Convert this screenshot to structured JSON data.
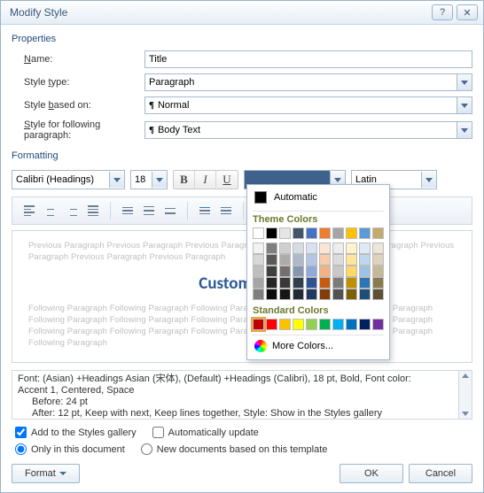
{
  "titlebar": {
    "title": "Modify Style",
    "help": "?",
    "close": "✕"
  },
  "sections": {
    "properties": "Properties",
    "formatting": "Formatting"
  },
  "props": {
    "name_label": "Name:",
    "name_value": "Title",
    "type_label": "Style type:",
    "type_value": "Paragraph",
    "based_label": "Style based on:",
    "based_value": "Normal",
    "based_icon": "¶",
    "follow_label": "Style for following paragraph:",
    "follow_value": "Body Text",
    "follow_icon": "¶"
  },
  "format": {
    "font": "Calibri (Headings)",
    "size": "18",
    "script": "Latin"
  },
  "preview": {
    "ghost_prev": "Previous Paragraph Previous Paragraph Previous Paragraph Previous Paragraph Previous Paragraph Previous Paragraph Previous Paragraph Previous Paragraph",
    "title": "Custom Wor",
    "ghost_foll": "Following Paragraph Following Paragraph Following Paragraph Following Paragraph Following Paragraph Following Paragraph Following Paragraph Following Paragraph Following Paragraph Following Paragraph Following Paragraph Following Paragraph Following Paragraph Following Paragraph Following Paragraph Following Paragraph"
  },
  "desc": {
    "l1": "Font: (Asian) +Headings Asian (宋体), (Default) +Headings (Calibri), 18 pt, Bold, Font color:",
    "l2": "Accent 1, Centered, Space",
    "l3": "Before:  24 pt",
    "l4": "After:  12 pt, Keep with next, Keep lines together, Style: Show in the Styles gallery"
  },
  "opts": {
    "add_gallery": "Add to the Styles gallery",
    "auto_update": "Automatically update",
    "only_doc": "Only in this document",
    "new_docs": "New documents based on this template"
  },
  "buttons": {
    "format": "Format",
    "ok": "OK",
    "cancel": "Cancel"
  },
  "popup": {
    "automatic": "Automatic",
    "theme": "Theme Colors",
    "standard": "Standard Colors",
    "more": "More Colors...",
    "theme_row": [
      "#ffffff",
      "#000000",
      "#e7e6e6",
      "#44546a",
      "#4472c4",
      "#ed7d31",
      "#a5a5a5",
      "#ffc000",
      "#5b9bd5",
      "#c7a96b"
    ],
    "theme_tints": [
      [
        "#f2f2f2",
        "#7f7f7f",
        "#d0cece",
        "#d6dce4",
        "#d9e2f3",
        "#fbe5d5",
        "#ededed",
        "#fff2cc",
        "#deebf6",
        "#ece5d8"
      ],
      [
        "#d8d8d8",
        "#595959",
        "#aeabab",
        "#adb9ca",
        "#b4c6e7",
        "#f7cbac",
        "#dbdbdb",
        "#fee599",
        "#bdd7ee",
        "#dcd2be"
      ],
      [
        "#bfbfbf",
        "#3f3f3f",
        "#757070",
        "#8496b0",
        "#8eaadb",
        "#f4b183",
        "#c9c9c9",
        "#ffd965",
        "#9cc3e5",
        "#c7b895"
      ],
      [
        "#a5a5a5",
        "#262626",
        "#3a3838",
        "#323f4f",
        "#2f5496",
        "#c55a11",
        "#7b7b7b",
        "#bf9000",
        "#2e75b5",
        "#8a7a4f"
      ],
      [
        "#7f7f7f",
        "#0c0c0c",
        "#171616",
        "#222a35",
        "#1f3864",
        "#833c0b",
        "#525252",
        "#7f6000",
        "#1e4e79",
        "#5c5135"
      ]
    ],
    "standard_row": [
      "#c00000",
      "#ff0000",
      "#ffc000",
      "#ffff00",
      "#92d050",
      "#00b050",
      "#00b0f0",
      "#0070c0",
      "#002060",
      "#7030a0"
    ]
  },
  "colors": {
    "selected_swatch": "#3f628d"
  }
}
